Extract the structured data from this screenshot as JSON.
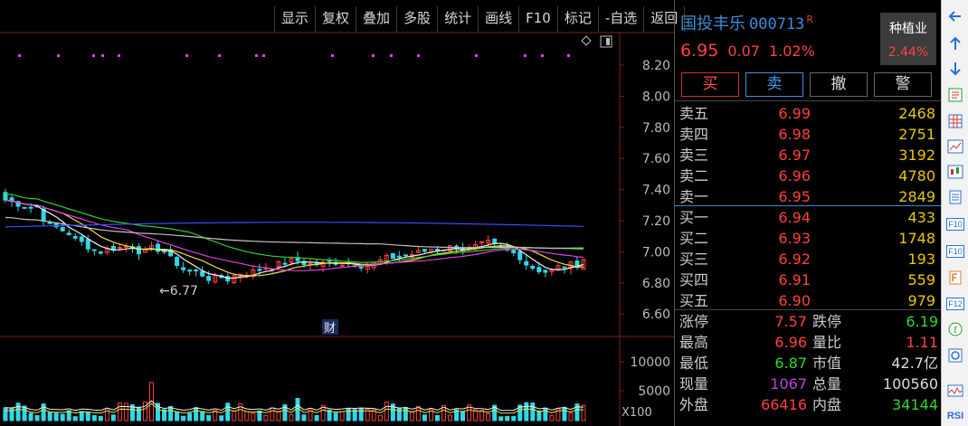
{
  "toolbar": [
    "显示",
    "复权",
    "叠加",
    "多股",
    "统计",
    "画线",
    "F10",
    "标记",
    "-自选",
    "返回"
  ],
  "stock": {
    "name": "国投丰乐",
    "code": "000713",
    "rzrq_badge": "R",
    "price": "6.95",
    "change": "0.07",
    "change_pct": "1.02%"
  },
  "sector": {
    "name": "种植业",
    "pct": "2.44%"
  },
  "actions": [
    "买",
    "卖",
    "撤",
    "警"
  ],
  "asks": [
    {
      "label": "卖五",
      "price": "6.99",
      "vol": "2468"
    },
    {
      "label": "卖四",
      "price": "6.98",
      "vol": "2751"
    },
    {
      "label": "卖三",
      "price": "6.97",
      "vol": "3192"
    },
    {
      "label": "卖二",
      "price": "6.96",
      "vol": "4780"
    },
    {
      "label": "卖一",
      "price": "6.95",
      "vol": "2849"
    }
  ],
  "bids": [
    {
      "label": "买一",
      "price": "6.94",
      "vol": "433"
    },
    {
      "label": "买二",
      "price": "6.93",
      "vol": "1748"
    },
    {
      "label": "买三",
      "price": "6.92",
      "vol": "193"
    },
    {
      "label": "买四",
      "price": "6.91",
      "vol": "559"
    },
    {
      "label": "买五",
      "price": "6.90",
      "vol": "979"
    }
  ],
  "stats": [
    {
      "l1": "涨停",
      "v1": "7.57",
      "c1": "red",
      "l2": "跌停",
      "v2": "6.19",
      "c2": "green"
    },
    {
      "l1": "最高",
      "v1": "6.96",
      "c1": "red",
      "l2": "量比",
      "v2": "1.11",
      "c2": "red"
    },
    {
      "l1": "最低",
      "v1": "6.87",
      "c1": "green",
      "l2": "市值",
      "v2": "42.7亿",
      "c2": "white"
    },
    {
      "l1": "现量",
      "v1": "1067",
      "c1": "purple",
      "l2": "总量",
      "v2": "100560",
      "c2": "white"
    },
    {
      "l1": "外盘",
      "v1": "66416",
      "c1": "red",
      "l2": "内盘",
      "v2": "34144",
      "c2": "green"
    }
  ],
  "chart": {
    "price_ticks": [
      "8.20",
      "8.00",
      "7.80",
      "7.60",
      "7.40",
      "7.20",
      "7.00",
      "6.80",
      "6.60"
    ],
    "volume_ticks": [
      "10000",
      "5000"
    ],
    "volume_unit": "X100",
    "low_marker": "←6.77",
    "finance_tag": "财"
  },
  "colors": {
    "up": "#ff4040",
    "down": "#2ed8e8",
    "ma5": "#f0f0f0",
    "ma10": "#f0e040",
    "ma20": "#e040e0",
    "ma30": "#30d030",
    "ma60": "#c0c0c0",
    "ma120": "#3050ff",
    "bg": "#000000"
  },
  "icons": [
    "back-arrow-icon",
    "up-arrow-icon",
    "down-arrow-icon",
    "info-doc-icon",
    "grid-table-icon",
    "line-chart-icon",
    "candle-chart-icon",
    "news-doc-icon",
    "f10-icon",
    "f10-alt-icon",
    "note-icon",
    "f12-icon",
    "formula-icon",
    "refresh-icon",
    "rsi-chart-icon",
    "rsi-label-icon"
  ],
  "icon_labels": {
    "f10": "F10",
    "f12": "F12",
    "rsi": "RSI"
  }
}
